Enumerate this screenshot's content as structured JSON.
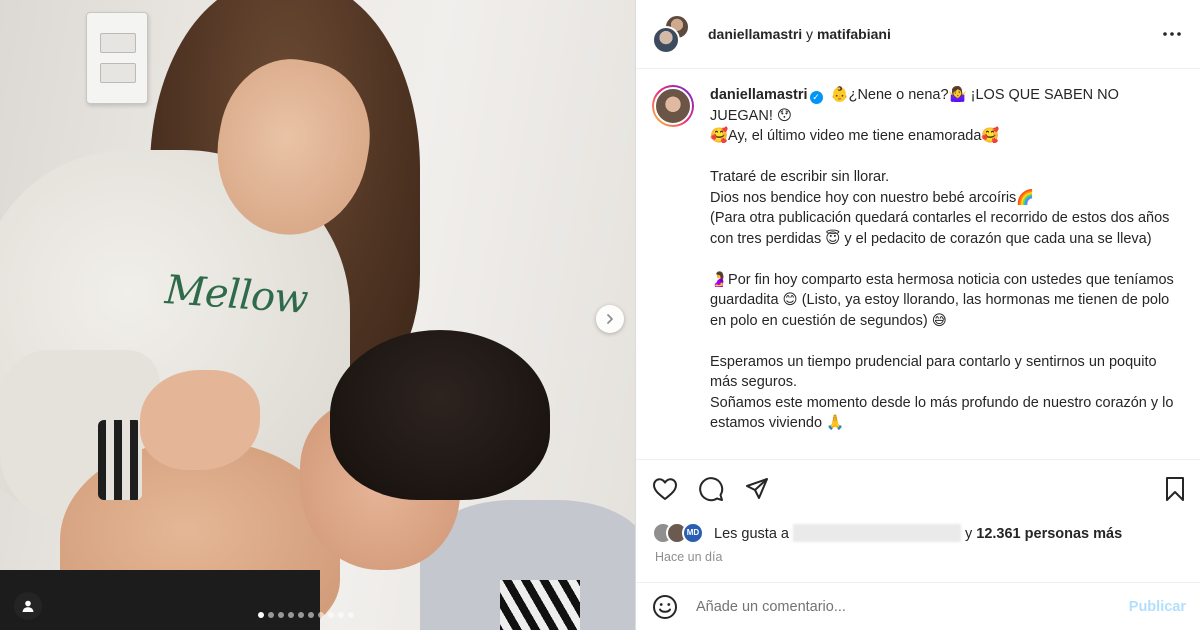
{
  "header": {
    "user1": "daniellamastri",
    "conjunction": "y",
    "user2": "matifabiani",
    "more_icon": "more-horizontal-icon"
  },
  "media": {
    "next_icon": "chevron-right-icon",
    "tag_icon": "user-tag-icon",
    "carousel_count": 10,
    "carousel_active": 0
  },
  "caption": {
    "username": "daniellamastri",
    "lines": {
      "l1": "👶¿Nene o nena?🤷‍♀️ ¡LOS QUE SABEN NO JUEGAN! 😯",
      "l2": "🥰Ay, el último video me tiene enamorada🥰",
      "l3": "Trataré de escribir sin llorar.",
      "l4": "Dios nos bendice hoy con nuestro bebé arcoíris🌈",
      "l5": "(Para otra publicación quedará contarles el recorrido de estos dos años con tres perdidas 😇 y el pedacito de corazón que cada una se lleva)",
      "l6": "🤰Por fin hoy comparto esta hermosa noticia con ustedes que teníamos guardadita 😊 (Listo, ya estoy llorando, las hormonas me tienen de polo en polo en cuestión de segundos) 😅",
      "l7": "Esperamos un tiempo prudencial para contarlo y sentirnos un poquito más seguros.",
      "l8": "Soñamos este momento desde lo más profundo de nuestro corazón y lo estamos viviendo 🙏"
    }
  },
  "actions": {
    "like_icon": "heart-icon",
    "comment_icon": "comment-icon",
    "share_icon": "share-icon",
    "save_icon": "bookmark-icon"
  },
  "likes": {
    "prefix": "Les gusta a",
    "suffix_conj": "y",
    "count_text": "12.361 personas más"
  },
  "time_ago": "Hace un día",
  "comment": {
    "placeholder": "Añade un comentario...",
    "post_label": "Publicar",
    "emoji_icon": "smiley-icon"
  },
  "colors": {
    "verified": "#0095f6",
    "post_disabled": "#b2dffc",
    "secondary_text": "#8e8e8e"
  }
}
